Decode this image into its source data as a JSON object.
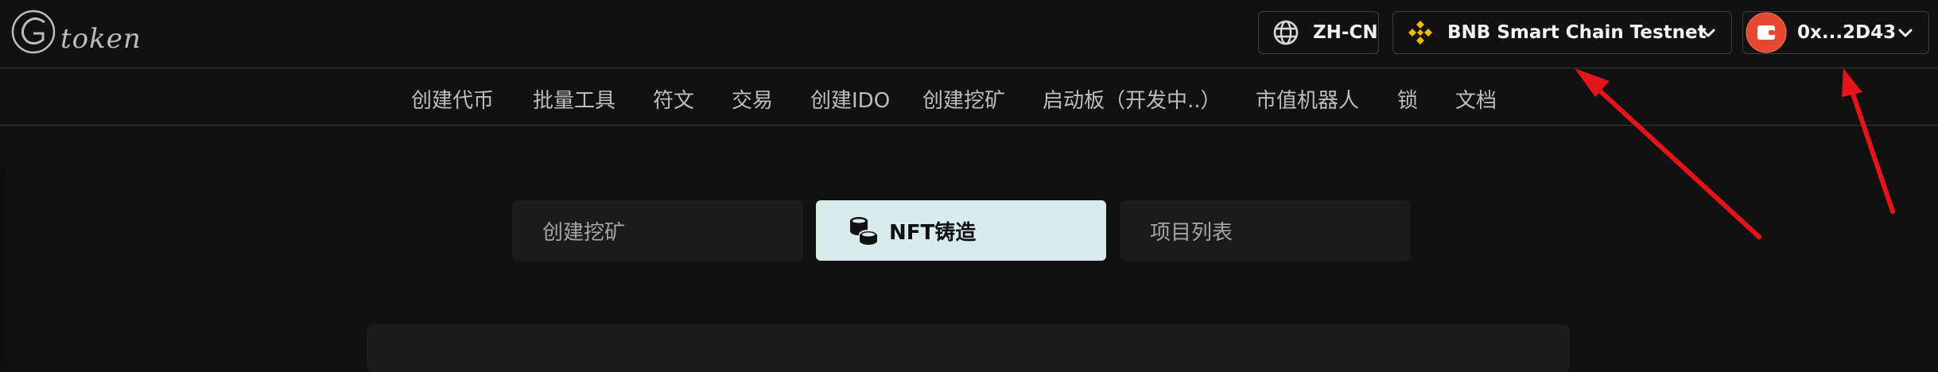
{
  "logo": {
    "text": "token"
  },
  "header": {
    "language": {
      "label": "ZH-CN",
      "icon": "globe-icon"
    },
    "network": {
      "label": "BNB Smart Chain Testnet",
      "icon": "bnb-icon"
    },
    "wallet": {
      "label": "0x...2D43",
      "icon": "wallet-icon"
    }
  },
  "nav": {
    "items": [
      {
        "label": "创建代币"
      },
      {
        "label": "批量工具"
      },
      {
        "label": "符文"
      },
      {
        "label": "交易"
      },
      {
        "label": "创建IDO"
      },
      {
        "label": "创建挖矿"
      },
      {
        "label": "启动板（开发中..）"
      },
      {
        "label": "市值机器人"
      },
      {
        "label": "锁"
      },
      {
        "label": "文档"
      }
    ]
  },
  "tabs": [
    {
      "label": "创建挖矿",
      "active": false
    },
    {
      "label": "NFT铸造",
      "active": true,
      "icon": "coins-icon"
    },
    {
      "label": "项目列表",
      "active": false
    }
  ],
  "colors": {
    "background": "#111111",
    "active_tab": "#d9eceb",
    "annotation_arrow": "#e3151b",
    "wallet_accent": "#e5482f"
  }
}
